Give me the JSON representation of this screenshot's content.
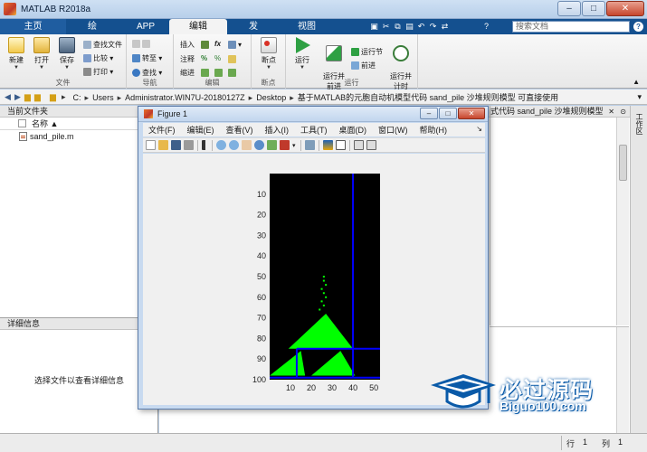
{
  "window": {
    "title": "MATLAB R2018a"
  },
  "tabs": [
    {
      "label": "主页"
    },
    {
      "label": "绘图"
    },
    {
      "label": "APP"
    },
    {
      "label": "编辑器"
    },
    {
      "label": "发布"
    },
    {
      "label": "视图"
    }
  ],
  "search": {
    "placeholder": "搜索文档"
  },
  "ribbon": {
    "file_group": {
      "label": "文件",
      "new": "新建",
      "open": "打开",
      "save": "保存",
      "find_files": "查找文件",
      "compare": "比较",
      "print": "打印"
    },
    "nav_group": {
      "label": "导航",
      "goto": "转至",
      "find": "查找"
    },
    "edit_group": {
      "label": "编辑",
      "insert": "插入",
      "comment": "注释",
      "indent": "缩进",
      "fx": "fx"
    },
    "bp_group": {
      "label": "断点",
      "breakpoints": "断点"
    },
    "run_group": {
      "label": "运行",
      "run": "运行",
      "run_advance": "运行并\n前进",
      "run_section": "运行节",
      "advance": "前进",
      "run_time": "运行并\n计时"
    }
  },
  "address": {
    "segments": [
      "C:",
      "Users",
      "Administrator.WIN7U-20180127Z",
      "Desktop",
      "基于MATLAB的元胞自动机模型代码 sand_pile 沙堆规则模型 可直接使用"
    ]
  },
  "current_folder": {
    "title": "当前文件夹",
    "column_name": "名称 ▲",
    "files": [
      {
        "name": "sand_pile.m"
      }
    ]
  },
  "details": {
    "title": "详细信息",
    "message": "选择文件以查看详细信息"
  },
  "editor_tab_text": "式代码 sand_pile 沙堆规则模型",
  "right_sidebar_label": "工作区",
  "status": {
    "row_label": "行",
    "row_value": "1",
    "col_label": "列",
    "col_value": "1"
  },
  "figure": {
    "title": "Figure 1",
    "menu": [
      "文件(F)",
      "编辑(E)",
      "查看(V)",
      "插入(I)",
      "工具(T)",
      "桌面(D)",
      "窗口(W)",
      "帮助(H)"
    ]
  },
  "chart_data": {
    "type": "heatmap",
    "title": "",
    "xlabel": "",
    "ylabel": "",
    "xlim": [
      0,
      53
    ],
    "ylim": [
      100,
      0
    ],
    "x_ticks": [
      10,
      20,
      30,
      40,
      50
    ],
    "y_ticks": [
      10,
      20,
      30,
      40,
      50,
      60,
      70,
      80,
      90,
      100
    ],
    "background": "#000000",
    "sand_color": "#00ff00",
    "wall_color": "#0000ff",
    "piles": [
      {
        "apex_x": 27,
        "apex_y": 68,
        "base_y": 85,
        "base_left": 9,
        "base_right": 40
      },
      {
        "apex_x": 34,
        "apex_y": 86,
        "base_y": 98,
        "base_left": 20,
        "base_right": 41
      },
      {
        "apex_x": 15,
        "apex_y": 86,
        "base_y": 98,
        "base_left": 0,
        "base_right": 17
      }
    ],
    "falling_grains": [
      [
        26,
        50
      ],
      [
        26,
        52
      ],
      [
        27,
        54
      ],
      [
        25,
        56
      ],
      [
        26,
        58
      ],
      [
        27,
        60
      ],
      [
        25,
        62
      ],
      [
        26,
        64
      ],
      [
        24,
        66
      ]
    ],
    "walls": {
      "vertical": [
        {
          "x": 40,
          "y_from": 0,
          "y_to": 99
        },
        {
          "x": 13,
          "y_from": 85,
          "y_to": 99
        }
      ],
      "horizontal": [
        {
          "y": 85,
          "x_from": 13,
          "x_to": 53
        },
        {
          "y": 99,
          "x_from": 0,
          "x_to": 53
        }
      ]
    }
  },
  "watermark": {
    "brand": "必过源码",
    "url": "Biguo100.com"
  }
}
